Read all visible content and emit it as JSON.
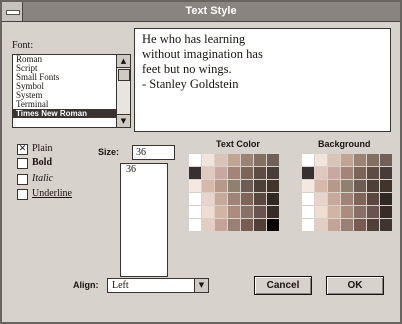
{
  "window": {
    "title": "Text Style"
  },
  "font_section": {
    "label": "Font:",
    "items": [
      "Roman",
      "Script",
      "Small Fonts",
      "Symbol",
      "System",
      "Terminal",
      "Times New Roman"
    ],
    "selected": "Times New Roman"
  },
  "sample_text": {
    "lines": [
      "He who has learning",
      "without imagination has",
      "feet but no wings.",
      "- Stanley Goldstein"
    ]
  },
  "styles": {
    "plain": {
      "label": "Plain",
      "checked": true
    },
    "bold": {
      "label": "Bold",
      "checked": false
    },
    "italic": {
      "label": "Italic",
      "checked": false
    },
    "underline": {
      "label": "Underline",
      "checked": false
    }
  },
  "size": {
    "label": "Size:",
    "value": "36",
    "list_items": [
      "36"
    ]
  },
  "text_color": {
    "label": "Text Color"
  },
  "background": {
    "label": "Background"
  },
  "align": {
    "label": "Align:",
    "value": "Left"
  },
  "buttons": {
    "cancel": "Cancel",
    "ok": "OK"
  },
  "icons": {
    "system_menu": "system-menu-icon",
    "scroll_up": "up-arrow-icon",
    "scroll_down": "down-arrow-icon",
    "dropdown": "down-arrow-icon"
  },
  "palette": {
    "text_color_swatches": [
      "#ffffff",
      "#f0e4dc",
      "#d8c4b8",
      "#c0a494",
      "#9c8474",
      "#847060",
      "#706058",
      "#383030",
      "#e0c8c0",
      "#c8a8a0",
      "#a48478",
      "#7c6458",
      "#5c4c44",
      "#483c38",
      "#f4e8e0",
      "#d8b8a8",
      "#b89888",
      "#908070",
      "#6c5c54",
      "#4c4038",
      "#40342c",
      "#ffffff",
      "#e8d4cc",
      "#c8a89c",
      "#a08478",
      "#806458",
      "#584840",
      "#302824",
      "#ffffff",
      "#f0dcd0",
      "#d0b4a4",
      "#ac8c7c",
      "#887068",
      "#685450",
      "#382c28",
      "#ffffff",
      "#e4cec4",
      "#c4a498",
      "#988074",
      "#785c54",
      "#504038",
      "#080404"
    ],
    "background_swatches": [
      "#ffffff",
      "#f0e4dc",
      "#d8c4b8",
      "#c0a494",
      "#9c8474",
      "#847060",
      "#706058",
      "#383030",
      "#e0c8c0",
      "#c8a8a0",
      "#a48478",
      "#7c6458",
      "#5c4c44",
      "#483c38",
      "#f4e8e0",
      "#d8b8a8",
      "#b89888",
      "#908070",
      "#6c5c54",
      "#4c4038",
      "#40342c",
      "#ffffff",
      "#e8d4cc",
      "#c8a89c",
      "#a08478",
      "#806458",
      "#584840",
      "#302824",
      "#ffffff",
      "#f0dcd0",
      "#d0b4a4",
      "#ac8c7c",
      "#887068",
      "#685450",
      "#382c28",
      "#ffffff",
      "#e4cec4",
      "#c4a498",
      "#988074",
      "#785c54",
      "#504038",
      "#403430"
    ]
  }
}
